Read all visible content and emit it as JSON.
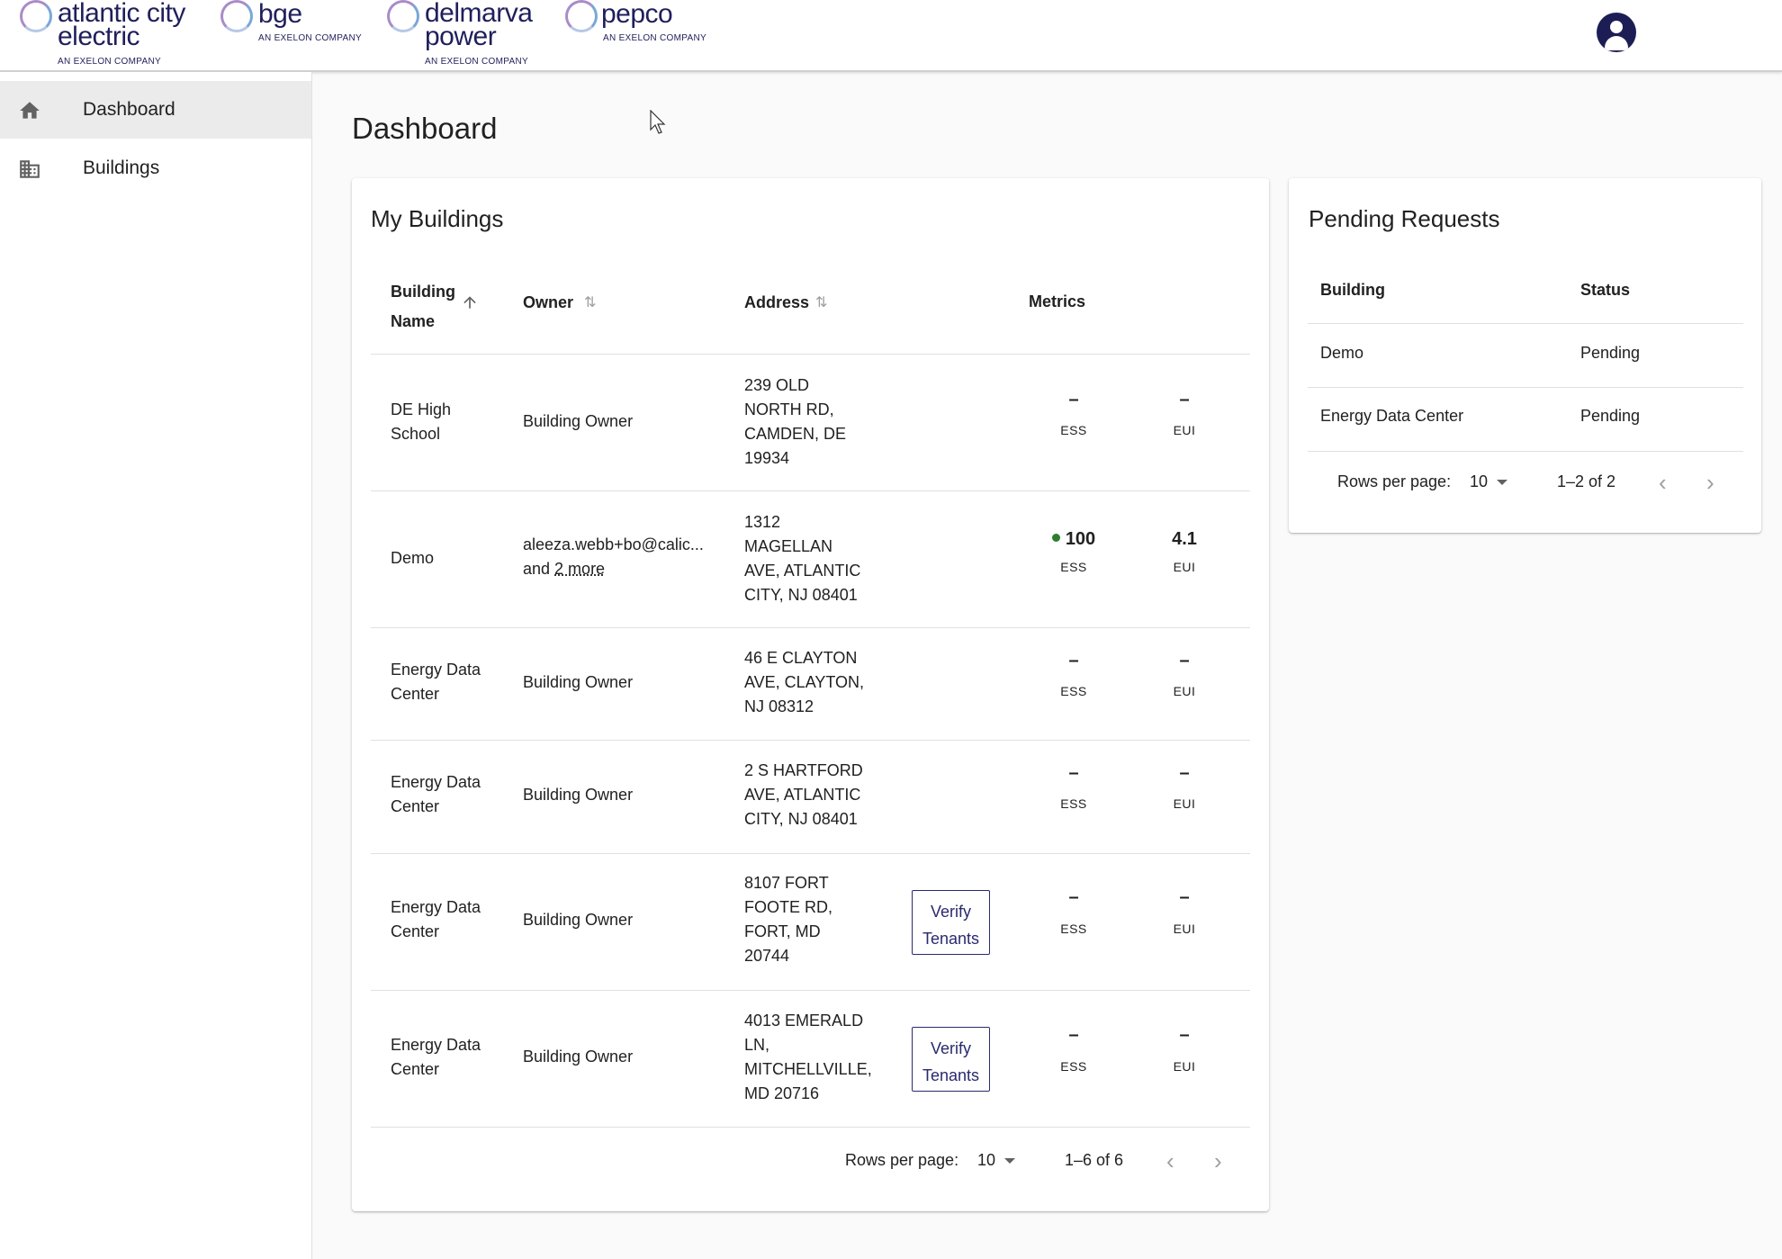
{
  "header": {
    "logos": [
      {
        "name": "atlantic city electric",
        "tag": "AN EXELON COMPANY"
      },
      {
        "name": "bge",
        "tag": "AN EXELON COMPANY"
      },
      {
        "name": "delmarva power",
        "tag": "AN EXELON COMPANY"
      },
      {
        "name": "pepco",
        "tag": "AN EXELON COMPANY"
      }
    ],
    "avatar_icon": "account-circle-icon"
  },
  "sidebar": {
    "items": [
      {
        "label": "Dashboard",
        "icon": "home-icon",
        "active": true
      },
      {
        "label": "Buildings",
        "icon": "buildings-icon",
        "active": false
      }
    ]
  },
  "page": {
    "title": "Dashboard"
  },
  "my_buildings": {
    "title": "My Buildings",
    "columns": {
      "name_line1": "Building",
      "name_line2": "Name",
      "owner": "Owner",
      "address": "Address",
      "metrics": "Metrics"
    },
    "rows": [
      {
        "name1": "DE High",
        "name2": "School",
        "owner": "Building Owner",
        "owner2": "",
        "addr": [
          "239 OLD",
          "NORTH RD,",
          "CAMDEN, DE",
          "19934"
        ],
        "verify": false,
        "ess": "–",
        "eui": "–",
        "ess_label": "ESS",
        "eui_label": "EUI"
      },
      {
        "name1": "Demo",
        "name2": "",
        "owner": "aleeza.webb+bo@calic...",
        "owner2_prefix": "and ",
        "owner2": "2 more",
        "addr": [
          "1312",
          "MAGELLAN",
          "AVE, ATLANTIC",
          "CITY, NJ 08401"
        ],
        "verify": false,
        "ess": "100",
        "eui": "4.1",
        "ess_label": "ESS",
        "eui_label": "EUI"
      },
      {
        "name1": "Energy Data",
        "name2": "Center",
        "owner": "Building Owner",
        "owner2": "",
        "addr": [
          "46 E CLAYTON",
          "AVE, CLAYTON,",
          "NJ 08312"
        ],
        "verify": false,
        "ess": "–",
        "eui": "–",
        "ess_label": "ESS",
        "eui_label": "EUI"
      },
      {
        "name1": "Energy Data",
        "name2": "Center",
        "owner": "Building Owner",
        "owner2": "",
        "addr": [
          "2 S HARTFORD",
          "AVE, ATLANTIC",
          "CITY, NJ 08401"
        ],
        "verify": false,
        "ess": "–",
        "eui": "–",
        "ess_label": "ESS",
        "eui_label": "EUI"
      },
      {
        "name1": "Energy Data",
        "name2": "Center",
        "owner": "Building Owner",
        "owner2": "",
        "addr": [
          "8107 FORT",
          "FOOTE RD,",
          "FORT, MD",
          "20744"
        ],
        "verify": true,
        "verify_line1": "Verify",
        "verify_line2": "Tenants",
        "ess": "–",
        "eui": "–",
        "ess_label": "ESS",
        "eui_label": "EUI"
      },
      {
        "name1": "Energy Data",
        "name2": "Center",
        "owner": "Building Owner",
        "owner2": "",
        "addr": [
          "4013 EMERALD",
          "LN,",
          "MITCHELLVILLE,",
          "MD 20716"
        ],
        "verify": true,
        "verify_line1": "Verify",
        "verify_line2": "Tenants",
        "ess": "–",
        "eui": "–",
        "ess_label": "ESS",
        "eui_label": "EUI"
      }
    ],
    "pagination": {
      "rows_per_page_label": "Rows per page:",
      "rows_per_page": "10",
      "range": "1–6 of 6"
    }
  },
  "pending_requests": {
    "title": "Pending Requests",
    "columns": {
      "building": "Building",
      "status": "Status"
    },
    "rows": [
      {
        "building": "Demo",
        "status": "Pending"
      },
      {
        "building": "Energy Data Center",
        "status": "Pending"
      }
    ],
    "pagination": {
      "rows_per_page_label": "Rows per page:",
      "rows_per_page": "10",
      "range": "1–2 of 2"
    }
  },
  "colors": {
    "brand": "#1d1d56",
    "ess_ok": "#2e7d32"
  }
}
